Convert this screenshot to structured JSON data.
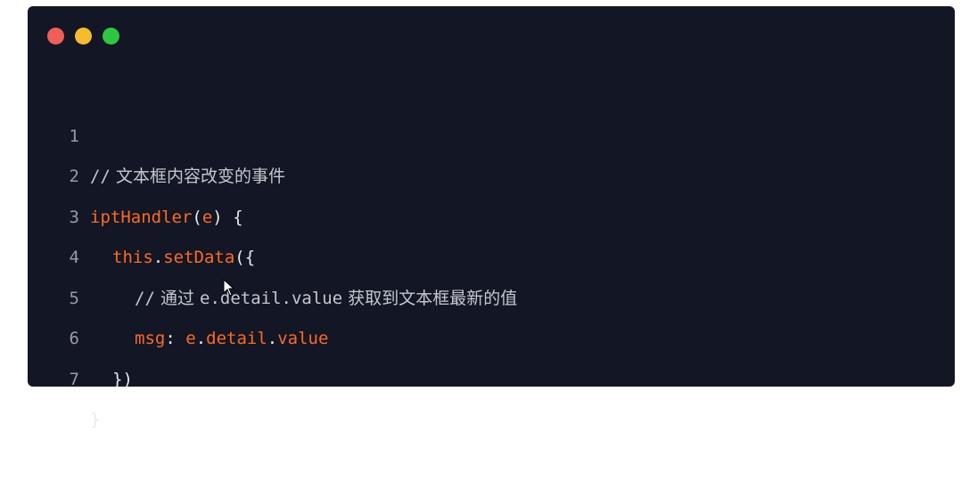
{
  "colors": {
    "window_bg": "#121625",
    "dot_red": "#f25d57",
    "dot_yellow": "#f5bc2e",
    "dot_green": "#2fc641",
    "keyword": "#ff6a1f",
    "text": "#e9e9ee",
    "comment": "#c6c7ce",
    "line_number": "#9a9ba6"
  },
  "window_controls": [
    "close-dot",
    "minimize-dot",
    "maximize-dot"
  ],
  "lines": [
    {
      "n": "1",
      "comment_slash": "//",
      "comment_text": "文本框内容改变的事件"
    },
    {
      "n": "2",
      "fn": "iptHandler",
      "p1": "(",
      "arg": "e",
      "p2": ")",
      "brace": " {"
    },
    {
      "n": "3",
      "obj": "this",
      "dot": ".",
      "method": "setData",
      "open": "({"
    },
    {
      "n": "4",
      "comment_slash": "//",
      "c1": "通过",
      "c2": "e.detail.value",
      "c3": "获取到文本框最新的值"
    },
    {
      "n": "5",
      "key": "msg",
      "colon": ":",
      "v1": "e",
      "d1": ".",
      "v2": "detail",
      "d2": ".",
      "v3": "value"
    },
    {
      "n": "6",
      "close": "})"
    },
    {
      "n": "7",
      "close": "}"
    }
  ]
}
